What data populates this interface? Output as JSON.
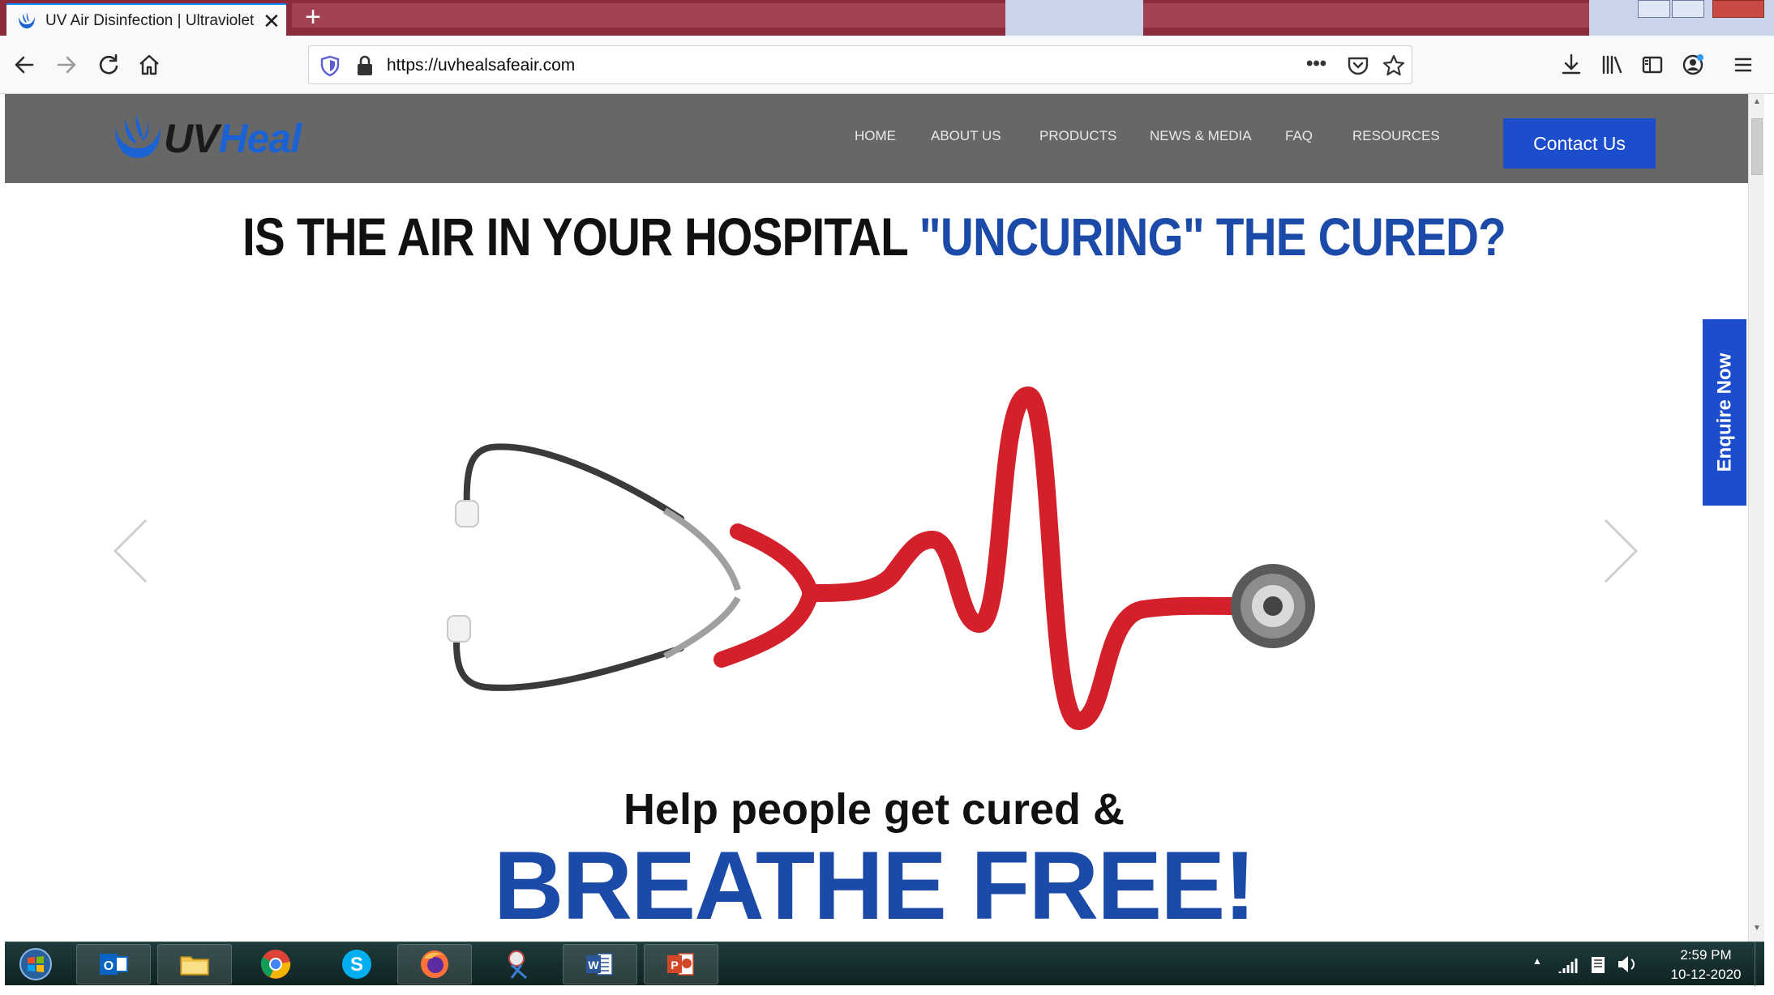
{
  "browser": {
    "tab_title": "UV Air Disinfection | Ultraviolet",
    "tab_close": "✕",
    "new_tab": "+",
    "url": "https://uvhealsafeair.com",
    "page_actions": "•••"
  },
  "site": {
    "logo_uv": "UV",
    "logo_heal": "Heal",
    "nav": [
      "HOME",
      "ABOUT US",
      "PRODUCTS",
      "NEWS & MEDIA",
      "FAQ",
      "RESOURCES"
    ],
    "contact_button": "Contact Us",
    "enquire_tab": "Enquire Now",
    "headline_black": "IS THE AIR IN YOUR HOSPITAL ",
    "headline_blue": "\"UNCURING\" THE CURED?",
    "tagline": "Help people get cured &",
    "tagline_big": "BREATHE FREE!",
    "colors": {
      "header_bg": "#676767",
      "brand_blue": "#1b4dcc",
      "headline_blue": "#1b4aa8",
      "stethoscope_red": "#d4202a"
    }
  },
  "taskbar": {
    "apps": [
      "start-orb-icon",
      "outlook-icon",
      "file-explorer-icon",
      "chrome-icon",
      "skype-icon",
      "firefox-icon",
      "snipping-tool-icon",
      "word-icon",
      "powerpoint-icon"
    ],
    "time": "2:59 PM",
    "date": "10-12-2020",
    "tray_arrow": "▲"
  }
}
